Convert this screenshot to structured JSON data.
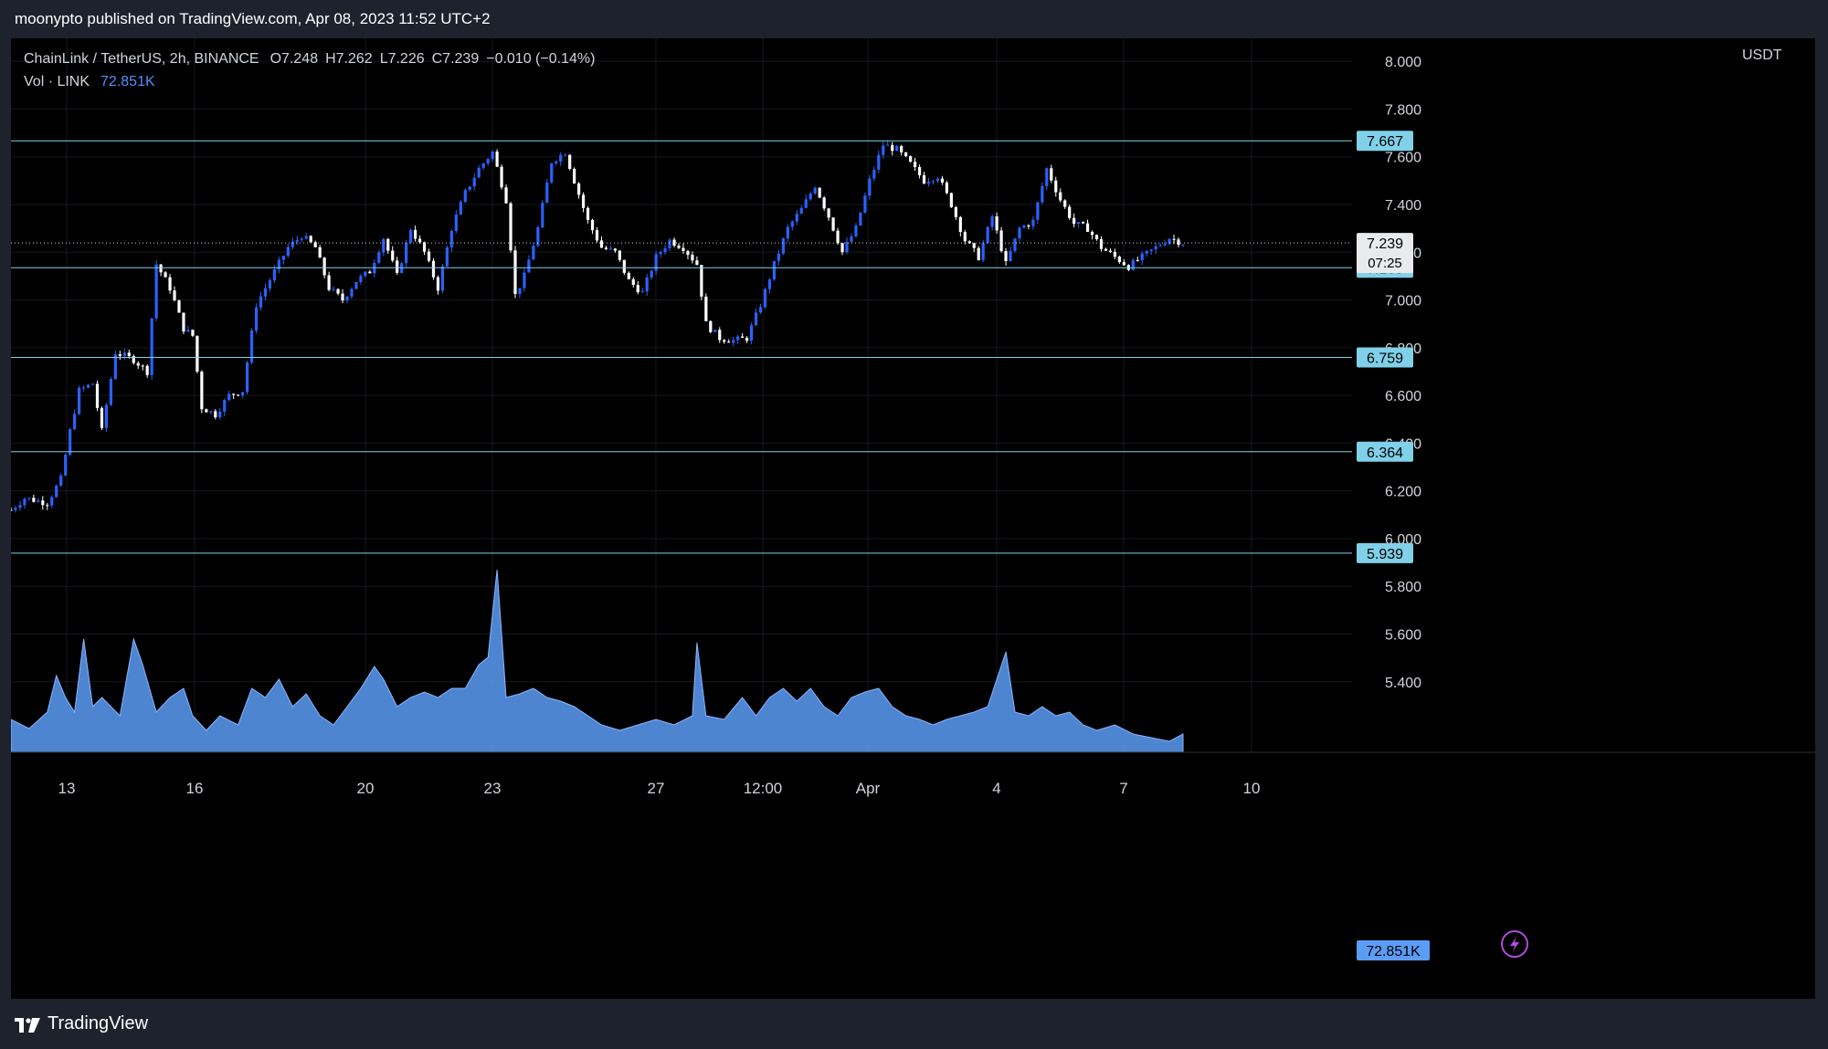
{
  "header": {
    "published_text": "moonypto published on TradingView.com, Apr 08, 2023 11:52 UTC+2"
  },
  "legend": {
    "symbol": "ChainLink / TetherUS, 2h, BINANCE",
    "open": "O7.248",
    "high": "H7.262",
    "low": "L7.226",
    "close": "C7.239",
    "change": "−0.010 (−0.14%)",
    "vol_label": "Vol · LINK",
    "vol_value": "72.851K"
  },
  "footer": {
    "brand": "TradingView"
  },
  "colors": {
    "background": "#000000",
    "frame": "#1e222d",
    "up_candle": "#2962ff",
    "down_candle": "#ffffff",
    "level_line": "#7fd0e8",
    "volume": "#5b9cf6",
    "last_price_badge": "#e8eaed"
  },
  "chart_data": {
    "type": "candlestick",
    "symbol": "ChainLink / TetherUS",
    "interval": "2h",
    "exchange": "BINANCE",
    "currency_label": "USDT",
    "ylim": [
      5.25,
      8.1
    ],
    "y_ticks": [
      "8.000",
      "7.800",
      "7.600",
      "7.400",
      "7.200",
      "7.000",
      "6.800",
      "6.600",
      "6.400",
      "6.200",
      "6.000",
      "5.800",
      "5.600",
      "5.400"
    ],
    "x_ticks": [
      "13",
      "16",
      "20",
      "23",
      "27",
      "12:00",
      "Apr",
      "4",
      "7",
      "10"
    ],
    "levels": [
      {
        "value": 7.667,
        "label": "7.667"
      },
      {
        "value": 7.135,
        "label": "7.135"
      },
      {
        "value": 6.759,
        "label": "6.759"
      },
      {
        "value": 6.364,
        "label": "6.364"
      },
      {
        "value": 5.939,
        "label": "5.939"
      }
    ],
    "last_price": {
      "value": 7.239,
      "label": "7.239",
      "countdown": "07:25"
    },
    "volume_label": "72.851K",
    "candles_close_path": [
      [
        0,
        6.12
      ],
      [
        3,
        6.17
      ],
      [
        8,
        6.15
      ],
      [
        11,
        6.25
      ],
      [
        13,
        6.45
      ],
      [
        15,
        6.62
      ],
      [
        18,
        6.65
      ],
      [
        20,
        6.45
      ],
      [
        23,
        6.78
      ],
      [
        27,
        6.75
      ],
      [
        30,
        6.7
      ],
      [
        32,
        7.15
      ],
      [
        35,
        7.05
      ],
      [
        38,
        6.88
      ],
      [
        40,
        6.85
      ],
      [
        42,
        6.55
      ],
      [
        45,
        6.52
      ],
      [
        48,
        6.6
      ],
      [
        51,
        6.62
      ],
      [
        54,
        6.98
      ],
      [
        58,
        7.12
      ],
      [
        61,
        7.22
      ],
      [
        64,
        7.27
      ],
      [
        67,
        7.22
      ],
      [
        70,
        7.05
      ],
      [
        73,
        7.0
      ],
      [
        76,
        7.08
      ],
      [
        79,
        7.12
      ],
      [
        82,
        7.26
      ],
      [
        85,
        7.1
      ],
      [
        88,
        7.3
      ],
      [
        91,
        7.2
      ],
      [
        94,
        7.05
      ],
      [
        97,
        7.3
      ],
      [
        100,
        7.45
      ],
      [
        103,
        7.55
      ],
      [
        106,
        7.62
      ],
      [
        109,
        7.42
      ],
      [
        111,
        7.02
      ],
      [
        113,
        7.1
      ],
      [
        116,
        7.3
      ],
      [
        119,
        7.58
      ],
      [
        122,
        7.62
      ],
      [
        124,
        7.5
      ],
      [
        127,
        7.33
      ],
      [
        130,
        7.22
      ],
      [
        133,
        7.2
      ],
      [
        136,
        7.08
      ],
      [
        139,
        7.03
      ],
      [
        142,
        7.18
      ],
      [
        145,
        7.25
      ],
      [
        148,
        7.22
      ],
      [
        151,
        7.15
      ],
      [
        153,
        6.9
      ],
      [
        156,
        6.84
      ],
      [
        159,
        6.83
      ],
      [
        162,
        6.84
      ],
      [
        165,
        6.98
      ],
      [
        168,
        7.15
      ],
      [
        171,
        7.3
      ],
      [
        174,
        7.38
      ],
      [
        177,
        7.48
      ],
      [
        180,
        7.35
      ],
      [
        183,
        7.2
      ],
      [
        186,
        7.3
      ],
      [
        189,
        7.5
      ],
      [
        192,
        7.65
      ],
      [
        195,
        7.63
      ],
      [
        198,
        7.57
      ],
      [
        201,
        7.5
      ],
      [
        204,
        7.52
      ],
      [
        207,
        7.4
      ],
      [
        210,
        7.25
      ],
      [
        213,
        7.18
      ],
      [
        216,
        7.35
      ],
      [
        219,
        7.15
      ],
      [
        222,
        7.3
      ],
      [
        225,
        7.33
      ],
      [
        228,
        7.55
      ],
      [
        231,
        7.42
      ],
      [
        234,
        7.32
      ],
      [
        237,
        7.3
      ],
      [
        240,
        7.22
      ],
      [
        243,
        7.18
      ],
      [
        246,
        7.14
      ],
      [
        249,
        7.18
      ],
      [
        252,
        7.22
      ],
      [
        255,
        7.26
      ],
      [
        258,
        7.239
      ]
    ],
    "volume_path": [
      [
        0,
        0.18
      ],
      [
        4,
        0.13
      ],
      [
        8,
        0.22
      ],
      [
        10,
        0.42
      ],
      [
        12,
        0.3
      ],
      [
        14,
        0.22
      ],
      [
        16,
        0.62
      ],
      [
        18,
        0.25
      ],
      [
        20,
        0.3
      ],
      [
        24,
        0.2
      ],
      [
        27,
        0.62
      ],
      [
        29,
        0.48
      ],
      [
        32,
        0.22
      ],
      [
        35,
        0.3
      ],
      [
        38,
        0.35
      ],
      [
        40,
        0.2
      ],
      [
        43,
        0.12
      ],
      [
        46,
        0.2
      ],
      [
        50,
        0.15
      ],
      [
        53,
        0.35
      ],
      [
        56,
        0.3
      ],
      [
        59,
        0.4
      ],
      [
        62,
        0.25
      ],
      [
        65,
        0.32
      ],
      [
        68,
        0.2
      ],
      [
        71,
        0.15
      ],
      [
        74,
        0.25
      ],
      [
        77,
        0.35
      ],
      [
        80,
        0.47
      ],
      [
        82,
        0.4
      ],
      [
        85,
        0.25
      ],
      [
        88,
        0.3
      ],
      [
        91,
        0.33
      ],
      [
        94,
        0.3
      ],
      [
        97,
        0.35
      ],
      [
        100,
        0.35
      ],
      [
        103,
        0.48
      ],
      [
        105,
        0.52
      ],
      [
        107,
        1.0
      ],
      [
        109,
        0.3
      ],
      [
        112,
        0.32
      ],
      [
        115,
        0.35
      ],
      [
        118,
        0.3
      ],
      [
        121,
        0.28
      ],
      [
        124,
        0.25
      ],
      [
        127,
        0.2
      ],
      [
        130,
        0.15
      ],
      [
        134,
        0.12
      ],
      [
        138,
        0.15
      ],
      [
        142,
        0.18
      ],
      [
        146,
        0.15
      ],
      [
        150,
        0.2
      ],
      [
        151,
        0.6
      ],
      [
        153,
        0.2
      ],
      [
        157,
        0.18
      ],
      [
        161,
        0.3
      ],
      [
        164,
        0.2
      ],
      [
        167,
        0.3
      ],
      [
        170,
        0.35
      ],
      [
        173,
        0.28
      ],
      [
        176,
        0.35
      ],
      [
        179,
        0.25
      ],
      [
        182,
        0.2
      ],
      [
        185,
        0.3
      ],
      [
        188,
        0.33
      ],
      [
        191,
        0.35
      ],
      [
        194,
        0.25
      ],
      [
        197,
        0.2
      ],
      [
        200,
        0.18
      ],
      [
        203,
        0.15
      ],
      [
        206,
        0.18
      ],
      [
        209,
        0.2
      ],
      [
        212,
        0.22
      ],
      [
        215,
        0.25
      ],
      [
        219,
        0.55
      ],
      [
        221,
        0.22
      ],
      [
        224,
        0.2
      ],
      [
        227,
        0.25
      ],
      [
        230,
        0.2
      ],
      [
        233,
        0.22
      ],
      [
        236,
        0.15
      ],
      [
        239,
        0.12
      ],
      [
        243,
        0.15
      ],
      [
        247,
        0.1
      ],
      [
        251,
        0.08
      ],
      [
        255,
        0.06
      ],
      [
        258,
        0.1
      ]
    ]
  }
}
